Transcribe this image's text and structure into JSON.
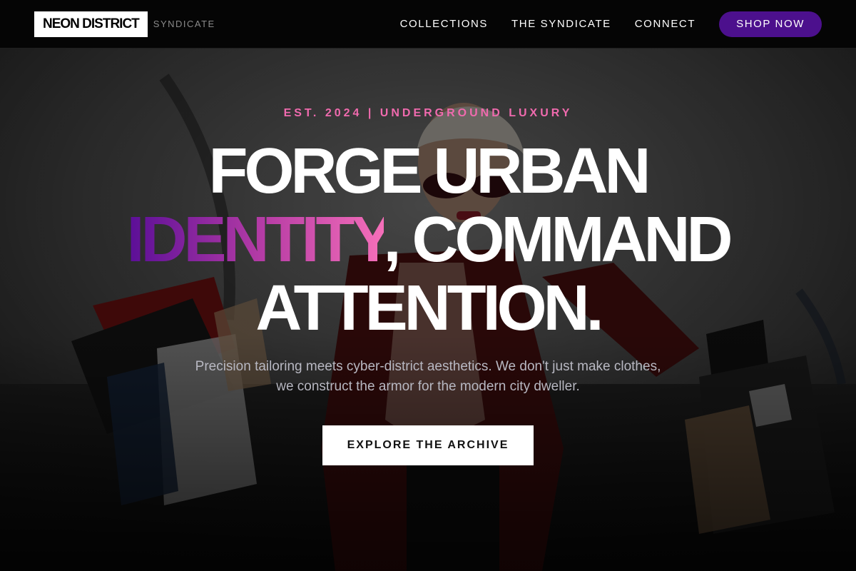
{
  "brand": {
    "logo_text": "NEON DISTRICT",
    "sub_label": "SYNDICATE"
  },
  "nav": {
    "links": [
      "COLLECTIONS",
      "THE SYNDICATE",
      "CONNECT"
    ],
    "cta_label": "SHOP NOW"
  },
  "hero": {
    "eyebrow": "EST. 2024 | UNDERGROUND LUXURY",
    "headline": {
      "line1": "FORGE URBAN",
      "accent_word": "IDENTITY",
      "line2_rest": ", COMMAND",
      "line3": "ATTENTION."
    },
    "subtext": "Precision tailoring meets cyber-district aesthetics. We don't just make clothes, we construct the armor for the modern city dweller.",
    "cta_label": "EXPLORE THE ARCHIVE",
    "background_image": "woman-with-shopping-bags-photo"
  },
  "colors": {
    "nav_background": "#050505",
    "shop_button": "#4c108d",
    "eyebrow_pink": "#f06aae",
    "accent_gradient_start": "#5a0e97",
    "accent_gradient_end": "#f56fb9",
    "cta_background": "#ffffff"
  }
}
